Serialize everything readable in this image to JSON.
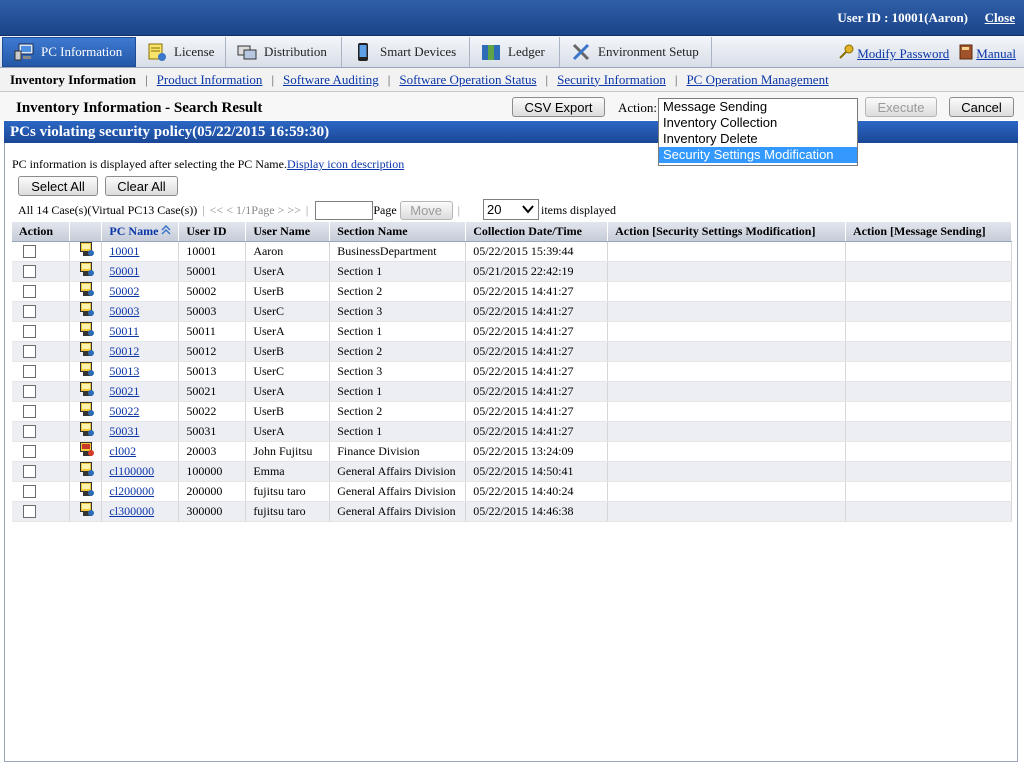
{
  "header": {
    "user": "User ID : 10001(Aaron)",
    "close": "Close"
  },
  "menu": {
    "tabs": [
      {
        "label": "PC Information",
        "icon": "pc-info-icon"
      },
      {
        "label": "License",
        "icon": "license-icon"
      },
      {
        "label": "Distribution",
        "icon": "distribution-icon"
      },
      {
        "label": "Smart Devices",
        "icon": "smart-device-icon"
      },
      {
        "label": "Ledger",
        "icon": "ledger-icon"
      },
      {
        "label": "Environment Setup",
        "icon": "wrench-icon"
      }
    ],
    "modify_password": "Modify Password",
    "manual": "Manual"
  },
  "subnav": {
    "current": "Inventory Information",
    "links": [
      "Product Information",
      "Software Auditing",
      "Software Operation Status",
      "Security Information",
      "PC Operation Management"
    ]
  },
  "page": {
    "title": "Inventory Information - Search Result",
    "csv_export": "CSV Export",
    "action_label": "Action:",
    "execute": "Execute",
    "cancel": "Cancel",
    "action_options": [
      "Message Sending",
      "Inventory Collection",
      "Inventory Delete",
      "Security Settings Modification"
    ],
    "action_selected": "Security Settings Modification"
  },
  "section": {
    "title": "PCs violating security policy(05/22/2015 16:59:30)",
    "info_text": "PC information is displayed after selecting the PC Name.",
    "info_link": "Display icon description",
    "select_all": "Select All",
    "clear_all": "Clear All"
  },
  "pager": {
    "count": "All 14 Case(s)(Virtual PC13 Case(s))",
    "nav": "<< < 1/1Page > >>",
    "page_label": "Page",
    "move": "Move",
    "per_page": "20",
    "items_label": "items displayed"
  },
  "table": {
    "headers": [
      "Action",
      "",
      "PC Name",
      "User ID",
      "User Name",
      "Section Name",
      "Collection Date/Time",
      "Action [Security Settings Modification]",
      "Action [Message Sending]"
    ],
    "rows": [
      {
        "pc": "10001",
        "uid": "10001",
        "user": "Aaron",
        "section": "BusinessDepartment",
        "date": "05/22/2015 15:39:44",
        "icon": "pc-icon"
      },
      {
        "pc": "50001",
        "uid": "50001",
        "user": "UserA",
        "section": "Section 1",
        "date": "05/21/2015 22:42:19",
        "icon": "pc-icon"
      },
      {
        "pc": "50002",
        "uid": "50002",
        "user": "UserB",
        "section": "Section 2",
        "date": "05/22/2015 14:41:27",
        "icon": "pc-icon"
      },
      {
        "pc": "50003",
        "uid": "50003",
        "user": "UserC",
        "section": "Section 3",
        "date": "05/22/2015 14:41:27",
        "icon": "pc-icon"
      },
      {
        "pc": "50011",
        "uid": "50011",
        "user": "UserA",
        "section": "Section 1",
        "date": "05/22/2015 14:41:27",
        "icon": "pc-icon"
      },
      {
        "pc": "50012",
        "uid": "50012",
        "user": "UserB",
        "section": "Section 2",
        "date": "05/22/2015 14:41:27",
        "icon": "pc-icon"
      },
      {
        "pc": "50013",
        "uid": "50013",
        "user": "UserC",
        "section": "Section 3",
        "date": "05/22/2015 14:41:27",
        "icon": "pc-icon"
      },
      {
        "pc": "50021",
        "uid": "50021",
        "user": "UserA",
        "section": "Section 1",
        "date": "05/22/2015 14:41:27",
        "icon": "pc-icon"
      },
      {
        "pc": "50022",
        "uid": "50022",
        "user": "UserB",
        "section": "Section 2",
        "date": "05/22/2015 14:41:27",
        "icon": "pc-icon"
      },
      {
        "pc": "50031",
        "uid": "50031",
        "user": "UserA",
        "section": "Section 1",
        "date": "05/22/2015 14:41:27",
        "icon": "pc-icon"
      },
      {
        "pc": "cl002",
        "uid": "20003",
        "user": "John Fujitsu",
        "section": "Finance Division",
        "date": "05/22/2015 13:24:09",
        "icon": "pc-alert-icon"
      },
      {
        "pc": "cl100000",
        "uid": "100000",
        "user": "Emma",
        "section": "General Affairs Division",
        "date": "05/22/2015 14:50:41",
        "icon": "pc-icon"
      },
      {
        "pc": "cl200000",
        "uid": "200000",
        "user": "fujitsu taro",
        "section": "General Affairs Division",
        "date": "05/22/2015 14:40:24",
        "icon": "pc-icon"
      },
      {
        "pc": "cl300000",
        "uid": "300000",
        "user": "fujitsu taro",
        "section": "General Affairs Division",
        "date": "05/22/2015 14:46:38",
        "icon": "pc-icon"
      }
    ]
  },
  "colors": {
    "header_blue": "#1b4489",
    "tab_active": "#2458a8",
    "link": "#0b36a8",
    "selection": "#3399ff"
  }
}
